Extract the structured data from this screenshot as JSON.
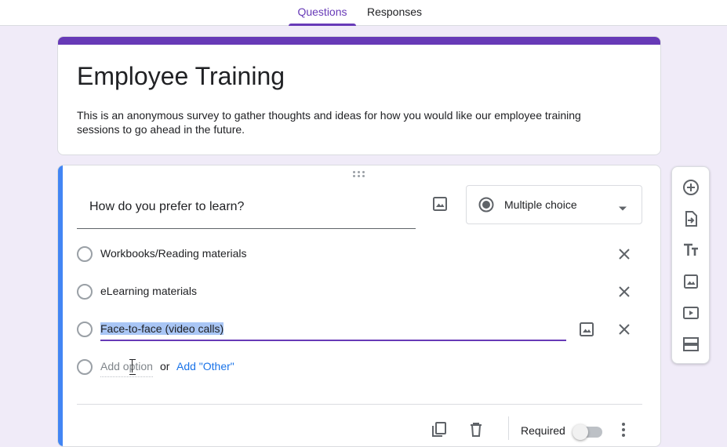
{
  "tabs": [
    {
      "label": "Questions",
      "active": true
    },
    {
      "label": "Responses",
      "active": false
    }
  ],
  "colors": {
    "theme": "#673ab7",
    "background": "#f0ebf8",
    "focus_accent": "#4285f4",
    "link": "#1a73e8",
    "selection": "#a9c6f5"
  },
  "form": {
    "title": "Employee Training",
    "description": "This is an anonymous survey to gather thoughts and ideas for how you would like our employee training sessions to go ahead in the future."
  },
  "question": {
    "title": "How do you prefer to learn?",
    "type_label": "Multiple choice",
    "options": [
      {
        "label": "Workbooks/Reading materials"
      },
      {
        "label": "eLearning materials"
      },
      {
        "label": "Face-to-face (video calls)"
      }
    ],
    "add_option_placeholder": "Add option",
    "or_text": "or",
    "add_other_label": "Add \"Other\"",
    "required_label": "Required",
    "required": false
  },
  "icons": {
    "drag": "drag-handle-icon",
    "image": "image-icon",
    "radio": "radio-button-icon",
    "dropdown": "chevron-down-icon",
    "remove": "close-icon",
    "duplicate": "copy-icon",
    "delete": "trash-icon",
    "more": "more-vertical-icon",
    "toolbar": [
      "add-circle-icon",
      "import-icon",
      "text-title-icon",
      "image-icon",
      "video-icon",
      "section-icon"
    ]
  }
}
